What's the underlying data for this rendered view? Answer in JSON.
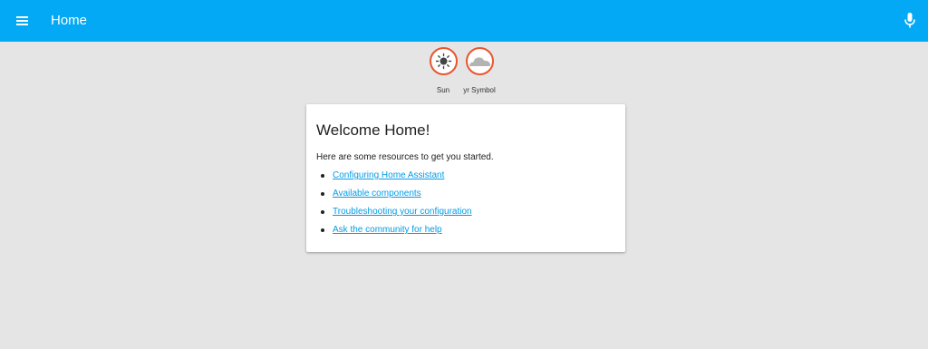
{
  "header": {
    "title": "Home",
    "menu_icon": "hamburger-menu-icon",
    "mic_icon": "microphone-icon",
    "background_color": "#03a9f4"
  },
  "badges": [
    {
      "label": "Sun",
      "icon": "sun-icon",
      "border_color": "#e8562f"
    },
    {
      "label": "yr Symbol",
      "icon": "cloud-icon",
      "border_color": "#e8562f"
    }
  ],
  "card": {
    "title": "Welcome Home!",
    "intro": "Here are some resources to get you started.",
    "links": [
      {
        "label": "Configuring Home Assistant"
      },
      {
        "label": "Available components"
      },
      {
        "label": "Troubleshooting your configuration"
      },
      {
        "label": "Ask the community for help"
      }
    ],
    "link_color": "#039be5"
  },
  "page": {
    "background_color": "#e5e5e5"
  }
}
